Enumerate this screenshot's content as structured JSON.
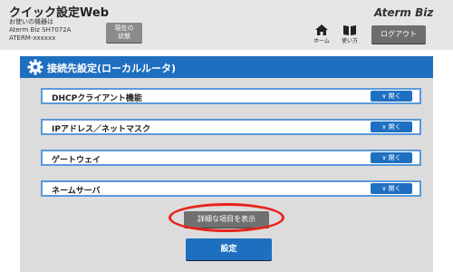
{
  "header": {
    "app_title": "クイック設定Web",
    "device_caption": "お使いの機器は",
    "device_model": "Aterm Biz SH7072A",
    "device_id": "ATERM-xxxxxx",
    "status_button_line1": "現在の",
    "status_button_line2": "状態",
    "brand": "Aterm Biz",
    "home_label": "ホーム",
    "howto_label": "使い方",
    "logout_label": "ログアウト"
  },
  "section": {
    "title": "接続先設定(ローカルルータ)",
    "icon": "gear-icon"
  },
  "accordion": {
    "open_label": "開く",
    "items": [
      {
        "label": "DHCPクライアント機能"
      },
      {
        "label": "IPアドレス／ネットマスク"
      },
      {
        "label": "ゲートウェイ"
      },
      {
        "label": "ネームサーバ"
      }
    ]
  },
  "actions": {
    "detail_label": "詳細な項目を表示",
    "submit_label": "設定"
  },
  "colors": {
    "accent_blue": "#1f6fc0",
    "highlight_red": "#e8231a",
    "header_gray": "#e6e6e6"
  }
}
